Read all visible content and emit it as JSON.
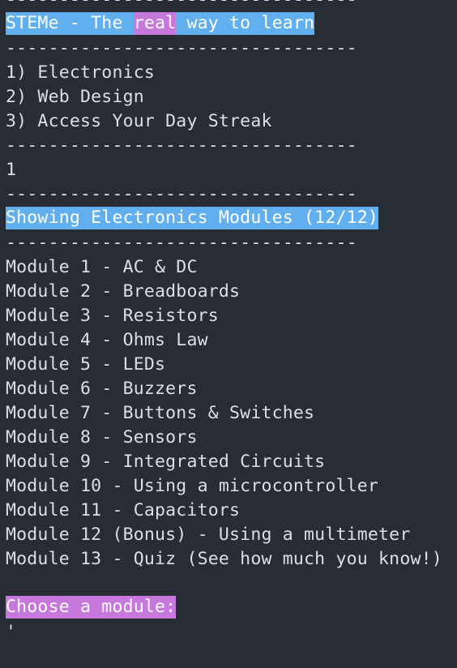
{
  "separator": "---------------------------------",
  "banner": {
    "prefix": "STEMe - The ",
    "highlight": "real",
    "suffix": " way to learn"
  },
  "menu": [
    "1) Electronics",
    "2) Web Design",
    "3) Access Your Day Streak"
  ],
  "user_input": "1",
  "modules_header": "Showing Electronics Modules (12/12)",
  "modules": [
    "Module 1 - AC & DC",
    "Module 2 - Breadboards",
    "Module 3 - Resistors",
    "Module 4 - Ohms Law",
    "Module 5 - LEDs",
    "Module 6 - Buzzers",
    "Module 7 - Buttons & Switches",
    "Module 8 - Sensors",
    "Module 9 - Integrated Circuits",
    "Module 10 - Using a microcontroller",
    "Module 11 - Capacitors",
    "Module 12 (Bonus) - Using a multimeter",
    "Module 13 - Quiz (See how much you know!)"
  ],
  "prompt": "Choose a module:",
  "cursor": "'",
  "colors": {
    "background": "#282c34",
    "text": "#dcdfe4",
    "blue_highlight": "#61afef",
    "purple_highlight": "#c678dd"
  }
}
